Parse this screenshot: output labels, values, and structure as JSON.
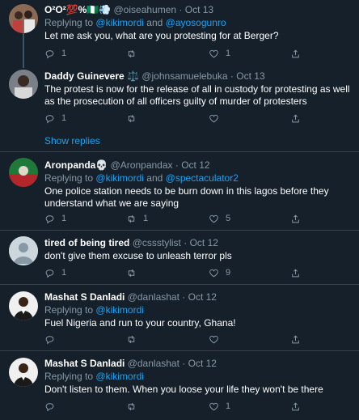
{
  "tweets": [
    {
      "name": "O²O²💯%🇳🇬💨",
      "handle": "@oiseahumen",
      "date": "Oct 13",
      "replying_prefix": "Replying to",
      "replying_to": "@kikimordi",
      "replying_joiner": "and",
      "replying_to2": "@ayosogunro",
      "text": "Let me ask you, what are you protesting for at Berger?",
      "replies": "1",
      "retweets": "",
      "likes": "1"
    },
    {
      "name": "Daddy Guinevere ⚖️",
      "handle": "@johnsamuelebuka",
      "date": "Oct 13",
      "text": "The protest is now for the release of all in custody for protesting as well as the prosecution of all officers guilty of murder of protesters",
      "replies": "1",
      "retweets": "",
      "likes": ""
    },
    {
      "name": "Aronpanda💀",
      "handle": "@Aronpandax",
      "date": "Oct 12",
      "replying_prefix": "Replying to",
      "replying_to": "@kikimordi",
      "replying_joiner": "and",
      "replying_to2": "@spectaculator2",
      "text": "One police station needs to be burn down  in this lagos before they understand what we are saying",
      "replies": "1",
      "retweets": "1",
      "likes": "5"
    },
    {
      "name": "tired of being tired",
      "handle": "@cssstylist",
      "date": "Oct 12",
      "text": "don't give them excuse to unleash terror pls",
      "replies": "1",
      "retweets": "",
      "likes": "9"
    },
    {
      "name": "Mashat S Danladi",
      "handle": "@danlashat",
      "date": "Oct 12",
      "replying_prefix": "Replying to",
      "replying_to": "@kikimordi",
      "text": "Fuel Nigeria and run to your country, Ghana!",
      "replies": "",
      "retweets": "",
      "likes": ""
    },
    {
      "name": "Mashat S Danladi",
      "handle": "@danlashat",
      "date": "Oct 12",
      "replying_prefix": "Replying to",
      "replying_to": "@kikimordi",
      "text": "Don't listen to them. When you loose your life they won't be there",
      "replies": "",
      "retweets": "",
      "likes": "1"
    }
  ],
  "show_replies": "Show replies",
  "separator": "·",
  "colors": {
    "background": "#15202b",
    "border": "#38444d",
    "text": "#ffffff",
    "secondary": "#8899a6",
    "link": "#1da1f2"
  },
  "icons": {
    "reply": "reply-icon",
    "retweet": "retweet-icon",
    "like": "heart-icon",
    "share": "share-icon"
  }
}
